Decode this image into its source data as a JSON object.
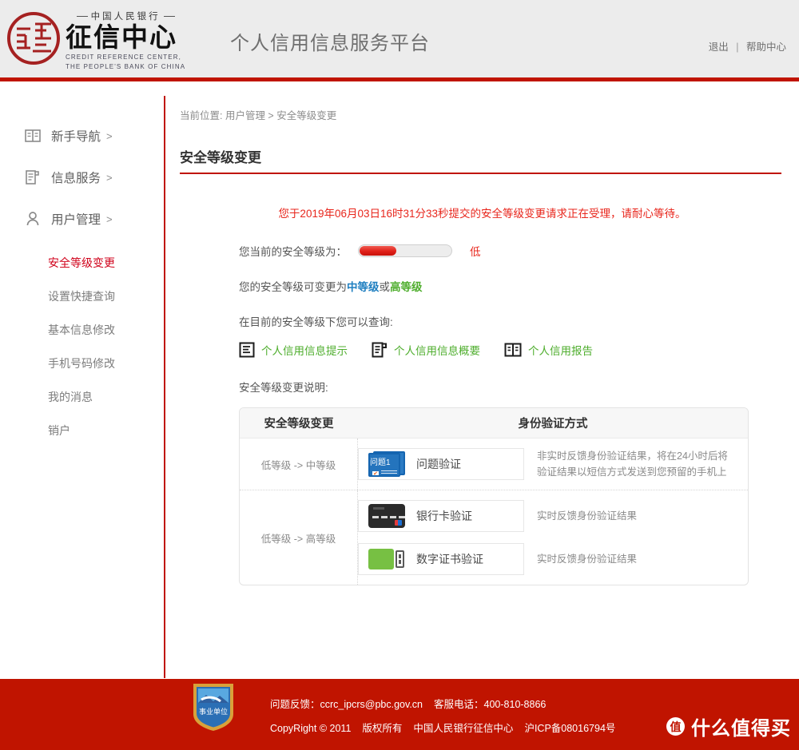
{
  "header": {
    "logo": {
      "top_line": "中国人民银行",
      "main": "征信中心",
      "en_line1": "CREDIT REFERENCE  CENTER,",
      "en_line2": "THE PEOPLE'S BANK OF CHINA"
    },
    "title": "个人信用信息服务平台",
    "logout_label": "退出",
    "separator": "|",
    "help_label": "帮助中心"
  },
  "sidebar": {
    "groups": [
      {
        "label": "新手导航",
        "chevron": ">",
        "icon": "book-icon"
      },
      {
        "label": "信息服务",
        "chevron": ">",
        "icon": "document-icon"
      },
      {
        "label": "用户管理",
        "chevron": ">",
        "icon": "user-icon"
      }
    ],
    "sub_items": [
      {
        "label": "安全等级变更",
        "active": true
      },
      {
        "label": "设置快捷查询",
        "active": false
      },
      {
        "label": "基本信息修改",
        "active": false
      },
      {
        "label": "手机号码修改",
        "active": false
      },
      {
        "label": "我的消息",
        "active": false
      },
      {
        "label": "销户",
        "active": false
      }
    ]
  },
  "main": {
    "breadcrumb": "当前位置: 用户管理 > 安全等级变更",
    "page_title": "安全等级变更",
    "notice": "您于2019年06月03日16时31分33秒提交的安全等级变更请求正在受理，请耐心等待。",
    "current_level_label": "您当前的安全等级为：",
    "current_level_value": "低",
    "level_fill_percent": 40,
    "change_prefix": "您的安全等级可变更为 ",
    "level_mid": "中等级",
    "change_conjunction": "或",
    "level_high": "高等级",
    "query_label": "在目前的安全等级下您可以查询:",
    "query_links": [
      {
        "text": "个人信用信息提示",
        "icon": "info-note-icon"
      },
      {
        "text": "个人信用信息概要",
        "icon": "summary-doc-icon"
      },
      {
        "text": "个人信用报告",
        "icon": "report-book-icon"
      }
    ],
    "table_label": "安全等级变更说明:",
    "table": {
      "headers": [
        "安全等级变更",
        "身份验证方式"
      ],
      "rows": [
        {
          "change": "低等级 -> 中等级",
          "methods": [
            {
              "name": "问题验证",
              "icon": "quiz-card-icon",
              "icon_text": "问题1",
              "desc": "非实时反馈身份验证结果，将在24小时后将验证结果以短信方式发送到您预留的手机上"
            }
          ]
        },
        {
          "change": "低等级 -> 高等级",
          "methods": [
            {
              "name": "银行卡验证",
              "icon": "bank-card-icon",
              "icon_text": "",
              "desc": "实时反馈身份验证结果"
            },
            {
              "name": "数字证书验证",
              "icon": "usb-key-icon",
              "icon_text": "",
              "desc": "实时反馈身份验证结果"
            }
          ]
        }
      ]
    }
  },
  "footer": {
    "badge_text": "事业单位",
    "line1_feedback_label": "问题反馈：",
    "line1_email": "ccrc_ipcrs@pbc.gov.cn",
    "line1_phone_label": "客服电话：",
    "line1_phone": "400-810-8866",
    "line2_copyright": "CopyRight © 2011",
    "line2_rights": "版权所有",
    "line2_org": "中国人民银行征信中心",
    "line2_icp": "沪ICP备08016794号",
    "watermark_mark": "值",
    "watermark_text": "什么值得买"
  },
  "colors": {
    "brand_red": "#c01400",
    "notice_red": "#e8261c",
    "mid_blue": "#1f7fc0",
    "high_green": "#4fae2e",
    "link_green": "#4fae2e"
  }
}
